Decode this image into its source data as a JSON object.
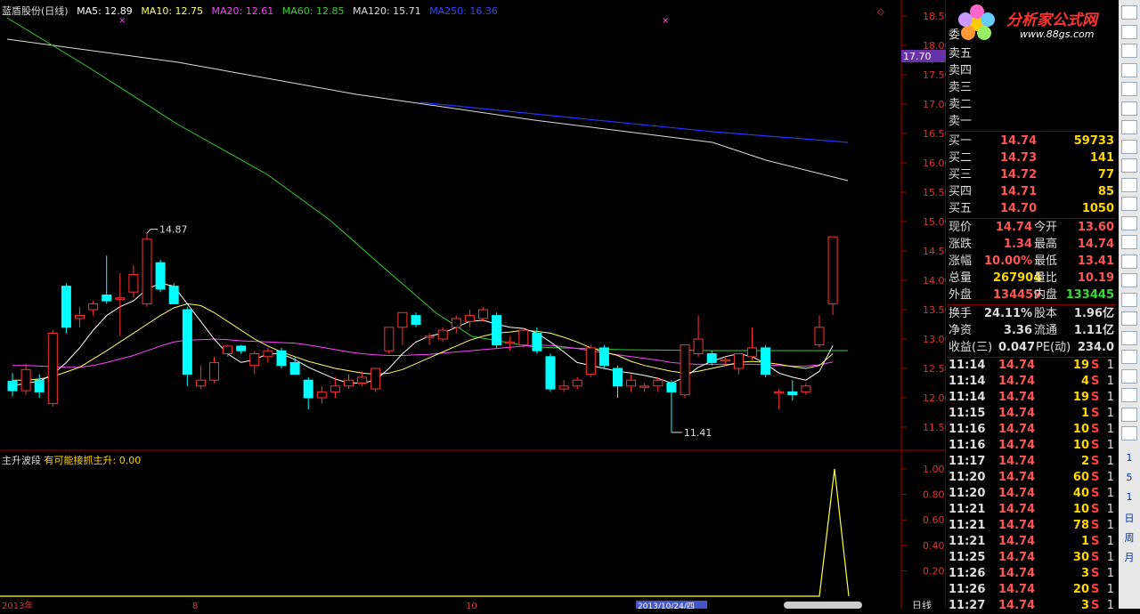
{
  "stock_title": "蓝盾股份(日线)",
  "ma_legend": [
    {
      "label": "MA5: 12.89",
      "color": "#ffffff"
    },
    {
      "label": "MA10: 12.75",
      "color": "#ffff66"
    },
    {
      "label": "MA20: 12.61",
      "color": "#ff44ff"
    },
    {
      "label": "MA60: 12.85",
      "color": "#33cc33"
    },
    {
      "label": "MA120: 15.71",
      "color": "#ffffff"
    },
    {
      "label": "MA250: 16.36",
      "color": "#2233ff"
    }
  ],
  "sub_legend": {
    "name": "主升波段",
    "text": "有可能接抓主升: 0.00"
  },
  "price_axis": [
    "18.50",
    "18.00",
    "17.50",
    "17.00",
    "16.50",
    "16.00",
    "15.50",
    "15.00",
    "14.50",
    "14.00",
    "13.50",
    "13.00",
    "12.50",
    "12.00",
    "11.50"
  ],
  "indicator_axis": [
    "1.00",
    "0.80",
    "0.60",
    "0.40",
    "0.20"
  ],
  "price_marker": "17.70",
  "high_label": "14.87",
  "low_label": "11.41",
  "date_labels": [
    "2013年",
    "8",
    "10"
  ],
  "date_cursor": "2013/10/24/四",
  "period_label": "日线",
  "logo": {
    "title": "分析家公式网",
    "url": "www.88gs.com"
  },
  "candles": [
    [
      12.28,
      12.42,
      12.02,
      12.12
    ],
    [
      12.12,
      12.58,
      12.05,
      12.48
    ],
    [
      12.3,
      12.4,
      12.0,
      12.1
    ],
    [
      11.9,
      13.15,
      11.85,
      13.1
    ],
    [
      13.9,
      13.95,
      13.1,
      13.2
    ],
    [
      13.35,
      13.55,
      13.2,
      13.4
    ],
    [
      13.5,
      13.65,
      13.4,
      13.6
    ],
    [
      13.75,
      14.42,
      13.6,
      13.65
    ],
    [
      13.7,
      14.12,
      13.05,
      13.7
    ],
    [
      13.8,
      14.25,
      13.7,
      14.1
    ],
    [
      13.6,
      14.8,
      13.55,
      14.7
    ],
    [
      14.3,
      14.35,
      13.8,
      13.85
    ],
    [
      13.9,
      13.95,
      13.6,
      13.6
    ],
    [
      13.5,
      13.55,
      12.2,
      12.4
    ],
    [
      12.2,
      12.55,
      12.15,
      12.3
    ],
    [
      12.3,
      12.7,
      12.25,
      12.6
    ],
    [
      12.75,
      12.9,
      12.7,
      12.88
    ],
    [
      12.88,
      12.9,
      12.75,
      12.8
    ],
    [
      12.55,
      12.8,
      12.4,
      12.75
    ],
    [
      12.7,
      12.85,
      12.6,
      12.8
    ],
    [
      12.8,
      12.85,
      12.5,
      12.55
    ],
    [
      12.6,
      12.7,
      12.4,
      12.4
    ],
    [
      12.3,
      12.35,
      11.8,
      12.0
    ],
    [
      12.0,
      12.2,
      11.9,
      12.1
    ],
    [
      12.1,
      12.35,
      12.0,
      12.2
    ],
    [
      12.2,
      12.4,
      12.15,
      12.3
    ],
    [
      12.25,
      12.45,
      12.2,
      12.35
    ],
    [
      12.15,
      12.5,
      12.1,
      12.5
    ],
    [
      12.8,
      13.2,
      12.75,
      13.2
    ],
    [
      13.2,
      13.35,
      12.9,
      13.45
    ],
    [
      13.4,
      13.45,
      13.2,
      13.25
    ],
    [
      13.05,
      13.1,
      12.9,
      13.05
    ],
    [
      13.0,
      13.2,
      12.95,
      13.15
    ],
    [
      13.2,
      13.4,
      13.1,
      13.35
    ],
    [
      13.3,
      13.5,
      13.2,
      13.4
    ],
    [
      13.35,
      13.55,
      13.3,
      13.5
    ],
    [
      13.4,
      13.45,
      12.85,
      12.9
    ],
    [
      12.95,
      13.05,
      12.8,
      12.95
    ],
    [
      12.9,
      13.2,
      12.85,
      13.15
    ],
    [
      13.1,
      13.2,
      12.75,
      12.8
    ],
    [
      12.7,
      12.75,
      12.1,
      12.15
    ],
    [
      12.15,
      12.3,
      12.1,
      12.2
    ],
    [
      12.2,
      12.35,
      12.15,
      12.3
    ],
    [
      12.4,
      12.9,
      12.35,
      12.85
    ],
    [
      12.85,
      12.9,
      12.5,
      12.55
    ],
    [
      12.5,
      12.55,
      12.0,
      12.2
    ],
    [
      12.2,
      12.4,
      12.1,
      12.3
    ],
    [
      12.2,
      12.25,
      12.1,
      12.2
    ],
    [
      12.2,
      12.35,
      12.1,
      12.3
    ],
    [
      12.25,
      12.3,
      11.41,
      12.1
    ],
    [
      12.05,
      12.9,
      12.0,
      12.9
    ],
    [
      12.75,
      13.4,
      12.7,
      13.0
    ],
    [
      12.75,
      12.8,
      12.55,
      12.6
    ],
    [
      12.65,
      12.7,
      12.55,
      12.65
    ],
    [
      12.5,
      12.75,
      12.4,
      12.75
    ],
    [
      12.7,
      13.2,
      12.65,
      12.85
    ],
    [
      12.85,
      12.9,
      12.35,
      12.4
    ],
    [
      12.1,
      12.15,
      11.8,
      12.1
    ],
    [
      12.1,
      12.3,
      11.95,
      12.05
    ],
    [
      12.1,
      12.25,
      12.05,
      12.2
    ],
    [
      12.9,
      13.4,
      12.85,
      13.2
    ],
    [
      13.6,
      14.74,
      13.41,
      14.74
    ]
  ],
  "ma": {
    "ma5": [
      12.2,
      12.25,
      12.28,
      12.4,
      12.6,
      12.85,
      13.15,
      13.4,
      13.55,
      13.65,
      13.85,
      13.95,
      13.9,
      13.6,
      13.3,
      13.0,
      12.75,
      12.6,
      12.65,
      12.75,
      12.75,
      12.65,
      12.52,
      12.42,
      12.32,
      12.25,
      12.25,
      12.3,
      12.5,
      12.75,
      12.95,
      13.05,
      13.1,
      13.2,
      13.3,
      13.32,
      13.25,
      13.2,
      13.18,
      13.1,
      12.95,
      12.78,
      12.6,
      12.55,
      12.5,
      12.45,
      12.42,
      12.38,
      12.33,
      12.25,
      12.35,
      12.52,
      12.62,
      12.7,
      12.75,
      12.7,
      12.58,
      12.42,
      12.35,
      12.3,
      12.45,
      12.89
    ],
    "ma10": [
      12.3,
      12.3,
      12.32,
      12.36,
      12.44,
      12.52,
      12.66,
      12.8,
      12.95,
      13.1,
      13.25,
      13.4,
      13.53,
      13.6,
      13.57,
      13.45,
      13.3,
      13.15,
      13.0,
      12.88,
      12.78,
      12.7,
      12.62,
      12.56,
      12.5,
      12.46,
      12.42,
      12.4,
      12.42,
      12.48,
      12.58,
      12.68,
      12.78,
      12.88,
      12.98,
      13.05,
      13.1,
      13.12,
      13.15,
      13.13,
      13.1,
      13.03,
      12.95,
      12.85,
      12.78,
      12.72,
      12.62,
      12.55,
      12.5,
      12.45,
      12.42,
      12.45,
      12.5,
      12.55,
      12.6,
      12.62,
      12.6,
      12.57,
      12.53,
      12.5,
      12.55,
      12.75
    ],
    "ma20": [
      12.55,
      12.55,
      12.54,
      12.53,
      12.52,
      12.52,
      12.55,
      12.6,
      12.66,
      12.72,
      12.8,
      12.88,
      12.95,
      12.98,
      12.99,
      13.0,
      12.99,
      12.97,
      12.96,
      12.95,
      12.94,
      12.93,
      12.9,
      12.86,
      12.82,
      12.78,
      12.75,
      12.73,
      12.72,
      12.72,
      12.73,
      12.74,
      12.76,
      12.78,
      12.8,
      12.82,
      12.84,
      12.86,
      12.88,
      12.9,
      12.89,
      12.87,
      12.84,
      12.8,
      12.77,
      12.73,
      12.7,
      12.67,
      12.64,
      12.6,
      12.58,
      12.57,
      12.57,
      12.57,
      12.57,
      12.57,
      12.56,
      12.55,
      12.54,
      12.54,
      12.56,
      12.61
    ]
  },
  "ma60_line": [
    [
      12.86,
      18.85
    ],
    [
      12.85,
      12.85
    ]
  ],
  "indicator": {
    "last_value": "0.00",
    "spike_value": 1.0
  }
}
